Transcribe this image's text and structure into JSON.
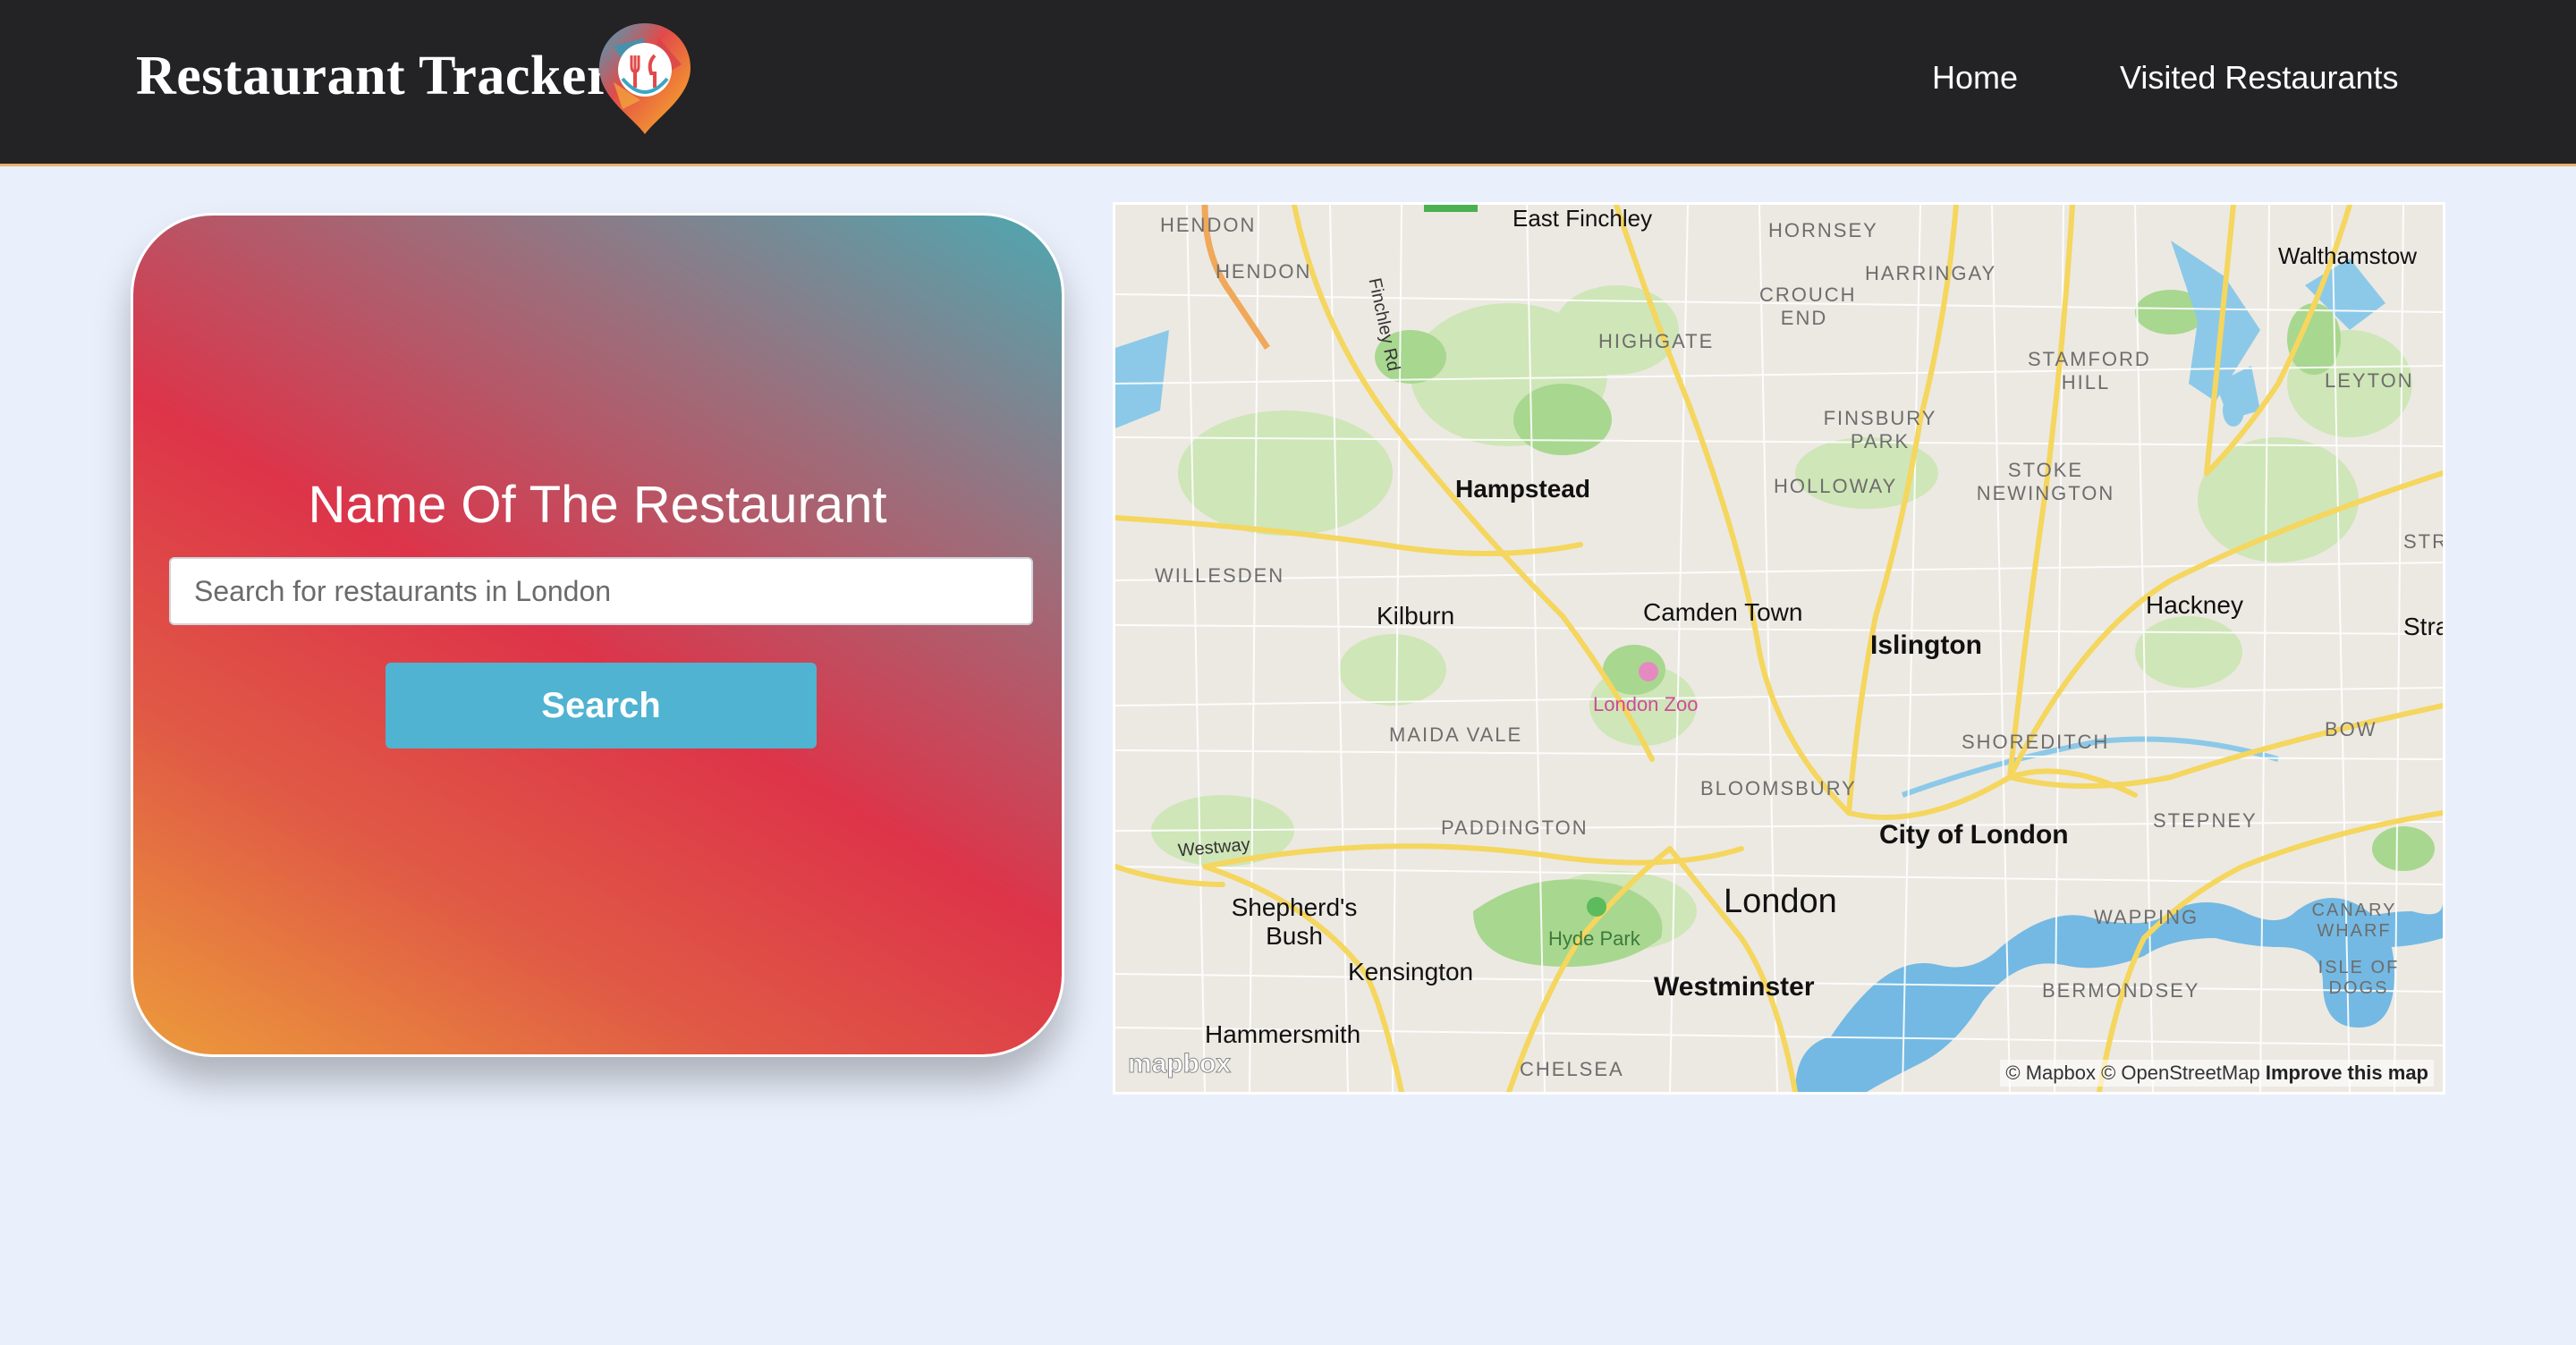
{
  "navbar": {
    "brand": "Restaurant Tracker",
    "logo_icon": "map-pin-restaurant-logo",
    "links": [
      {
        "label": "Home"
      },
      {
        "label": "Visited Restaurants"
      }
    ]
  },
  "search": {
    "title": "Name Of The Restaurant",
    "placeholder": "Search for restaurants in London",
    "button_label": "Search"
  },
  "map": {
    "places": {
      "hendon1": "HENDON",
      "hendon2": "HENDON",
      "east_finchley": "East Finchley",
      "finchley_rd": "Finchley Rd",
      "hornsey": "HORNSEY",
      "harringay": "HARRINGAY",
      "crouch_end": "CROUCH END",
      "walthamstow": "Walthamstow",
      "highgate": "HIGHGATE",
      "stamford_hill": "STAMFORD HILL",
      "leyton": "LEYTON",
      "finsbury_park": "FINSBURY PARK",
      "hampstead": "Hampstead",
      "holloway": "HOLLOWAY",
      "stoke_newington": "STOKE NEWINGTON",
      "str": "STR",
      "willesden": "WILLESDEN",
      "kilburn": "Kilburn",
      "camden_town": "Camden Town",
      "islington": "Islington",
      "hackney": "Hackney",
      "stra": "Stra",
      "london_zoo": "London Zoo",
      "maida_vale": "MAIDA VALE",
      "shoreditch": "SHOREDITCH",
      "bow": "BOW",
      "bloomsbury": "BLOOMSBURY",
      "paddington": "PADDINGTON",
      "city_of_london": "City of London",
      "stepney": "STEPNEY",
      "westway": "Westway",
      "shepherds_bush": "Shepherd's Bush",
      "london": "London",
      "hyde_park": "Hyde Park",
      "wapping": "WAPPING",
      "canary_wharf": "CANARY WHARF",
      "kensington": "Kensington",
      "westminster": "Westminster",
      "bermondsey": "BERMONDSEY",
      "isle_of_dogs": "ISLE OF DOGS",
      "hammersmith": "Hammersmith",
      "chelsea": "CHELSEA"
    },
    "logo": "mapbox",
    "attribution": "© Mapbox © OpenStreetMap",
    "improve": "Improve this map"
  }
}
